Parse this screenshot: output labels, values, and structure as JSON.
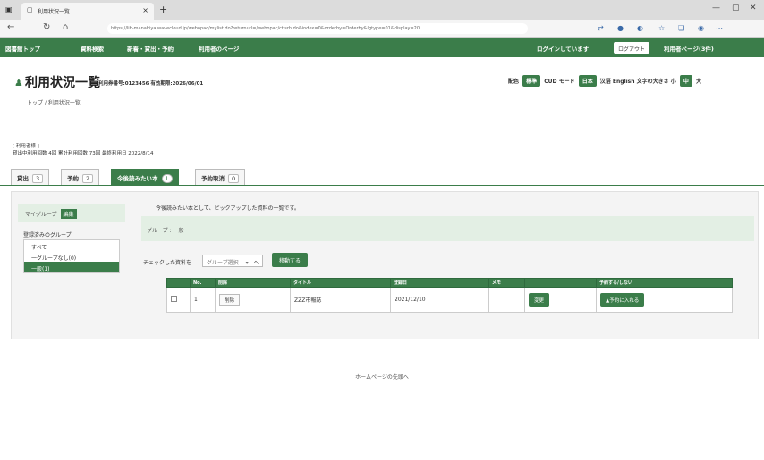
{
  "browser": {
    "tab_title": "利用状況一覧",
    "url": "https://lib-manabiya.wavecloud.jp/webopac/mylist.do?returnurl=/webopac/ctlsrh.do&index=0&orderby=Orderby&lgtype=01&display=20",
    "new_tab": "+",
    "close_tab": "×"
  },
  "nav": {
    "items": [
      "図書館トップ",
      "資料検索",
      "新着・貸出・予約",
      "利用者のページ"
    ],
    "login_text": "ログインしています",
    "logout": "ログアウト",
    "mypage": "利用者ページ(3件)"
  },
  "header": {
    "title": "利用状況一覧",
    "card_info": "利用券番号:0123456 有効期限:2026/06/01",
    "breadcrumb": "トップ / 利用状況一覧",
    "access_label": "配色",
    "color_btn": "標準",
    "cud": "CUD",
    "contrast": "モード",
    "lang_ja": "日本",
    "lang_zh": "汉语",
    "lang_en": "English",
    "font_label": "文字の大きさ",
    "font_minus": "小",
    "font_std": "中",
    "font_plus": "大"
  },
  "user": {
    "heading": "[ 利用者様 ]",
    "info": "貸出中利用回数 4回 累計利用回数 73回 最終利用日 2022/8/14"
  },
  "tabs": [
    {
      "label": "貸出",
      "count": "3"
    },
    {
      "label": "予約",
      "count": "2"
    },
    {
      "label": "今後読みたい本",
      "count": "1"
    },
    {
      "label": "予約取消",
      "count": "0"
    }
  ],
  "sidebar": {
    "mygroup": "マイグループ",
    "edit": "編集",
    "group_label": "登録済みのグループ",
    "groups": [
      "すべて",
      "一グループなし(0)",
      "一般(1)"
    ]
  },
  "main": {
    "description": "今後読みたい本として、ピックアップした資料の一覧です。",
    "group_bar": "グループ : 一般",
    "check_label": "チェックした資料を",
    "select_placeholder": "グループ選択",
    "select_suffix": "へ",
    "move_btn": "移動する"
  },
  "table": {
    "headers": [
      "",
      "No.",
      "削除",
      "タイトル",
      "登録日",
      "メモ",
      "",
      "予約する/しない"
    ],
    "rows": [
      {
        "no": "1",
        "delete": "削除",
        "title": "ZZZ市報誌",
        "date": "2021/12/10",
        "memo": "",
        "change": "変更",
        "reserve": "▲予約に入れる"
      }
    ]
  },
  "footer": {
    "home": "ホームページの先頭へ"
  }
}
